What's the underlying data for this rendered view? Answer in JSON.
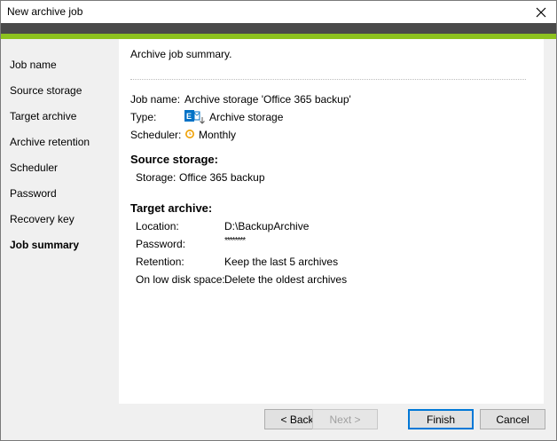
{
  "window": {
    "title": "New archive job"
  },
  "sidebar": {
    "items": [
      {
        "label": "Job name"
      },
      {
        "label": "Source storage"
      },
      {
        "label": "Target archive"
      },
      {
        "label": "Archive retention"
      },
      {
        "label": "Scheduler"
      },
      {
        "label": "Password"
      },
      {
        "label": "Recovery key"
      },
      {
        "label": "Job summary",
        "active": true
      }
    ]
  },
  "summary": {
    "heading": "Archive job summary.",
    "job_name_label": "Job name:",
    "job_name_value": "Archive storage 'Office 365 backup'",
    "type_label": "Type:",
    "type_value": "Archive storage",
    "type_icon": "exchange-archive-icon",
    "scheduler_label": "Scheduler:",
    "scheduler_value": "Monthly",
    "scheduler_icon": "clock-icon",
    "source_heading": "Source storage:",
    "storage_label": "Storage:",
    "storage_value": "Office 365 backup",
    "target_heading": "Target archive:",
    "location_label": "Location:",
    "location_value": "D:\\BackupArchive",
    "password_label": "Password:",
    "password_value": "********",
    "retention_label": "Retention:",
    "retention_value": "Keep the last 5 archives",
    "low_disk_label": "On low disk space:",
    "low_disk_value": "Delete the oldest archives"
  },
  "buttons": {
    "back": "< Back",
    "next": "Next >",
    "finish": "Finish",
    "cancel": "Cancel"
  },
  "colors": {
    "accent_green": "#8dc21f",
    "header_dark": "#4a4a4a",
    "clock_orange": "#f0a30a",
    "exchange_blue": "#0072c6"
  }
}
